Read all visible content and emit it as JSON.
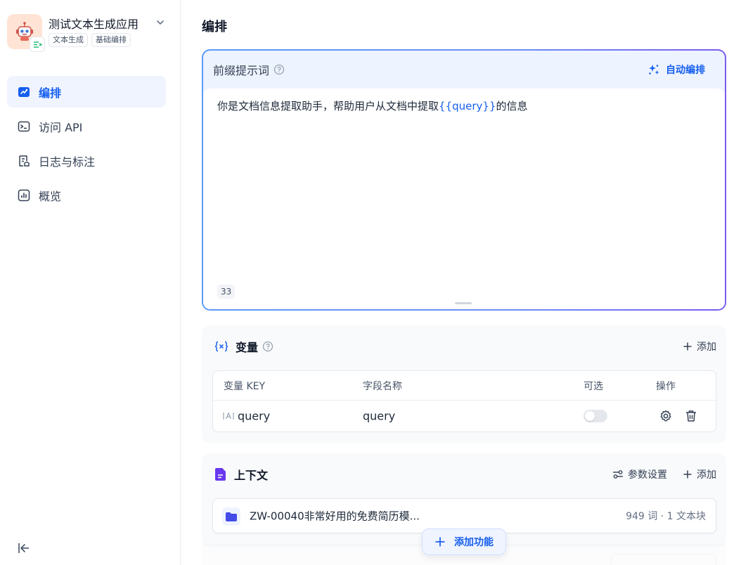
{
  "app": {
    "title": "测试文本生成应用",
    "tags": [
      "文本生成",
      "基础编排"
    ],
    "icon": "robot-icon"
  },
  "nav": {
    "items": [
      {
        "label": "编排",
        "icon": "orchestrate-icon",
        "active": true
      },
      {
        "label": "访问 API",
        "icon": "terminal-icon"
      },
      {
        "label": "日志与标注",
        "icon": "log-icon"
      },
      {
        "label": "概览",
        "icon": "chart-icon"
      }
    ]
  },
  "page": {
    "title": "编排"
  },
  "prompt": {
    "title": "前缀提示词",
    "auto_label": "自动编排",
    "text_before": "你是文档信息提取助手，帮助用户从文档中提取",
    "text_var": "{{query}}",
    "text_after": "的信息",
    "char_count": "33"
  },
  "variables": {
    "title": "变量",
    "add_label": "添加",
    "columns": [
      "变量 KEY",
      "字段名称",
      "可选",
      "操作"
    ],
    "rows": [
      {
        "key": "query",
        "name": "query",
        "optional": false
      }
    ]
  },
  "context": {
    "title": "上下文",
    "settings_label": "参数设置",
    "add_label": "添加",
    "doc_name": "ZW-00040非常好用的免费简历模...",
    "doc_meta": "949 词 · 1 文本块"
  },
  "add_feature_label": "添加功能",
  "colors": {
    "accent": "#155eef",
    "card_bg": "#f9fafb",
    "prompt_bg": "#eef4ff"
  }
}
